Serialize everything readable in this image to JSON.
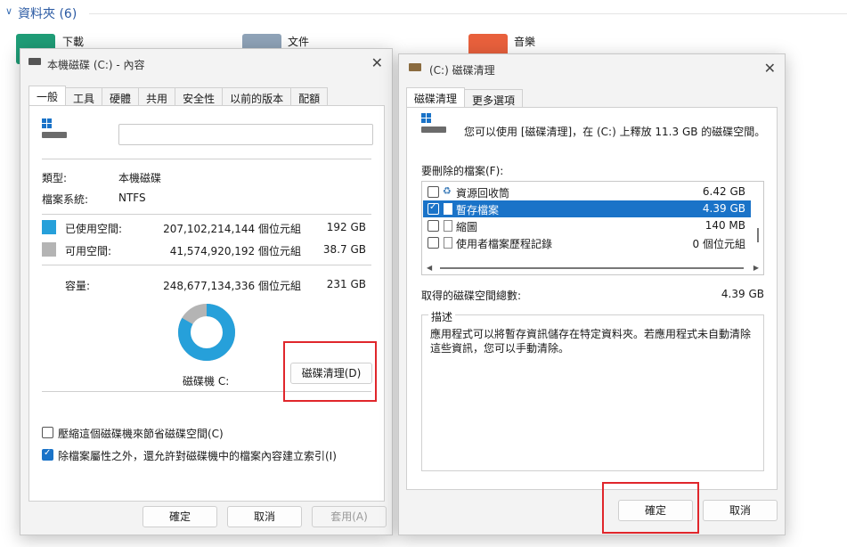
{
  "explorer": {
    "section_title": "資料夾 (6)",
    "folders": [
      {
        "label": "下載",
        "color": "#1f9d77"
      },
      {
        "label": "文件",
        "color": "#8fa3b8"
      },
      {
        "label": "音樂",
        "color": "#e8603c"
      }
    ]
  },
  "props": {
    "title": "本機磁碟 (C:) - 內容",
    "tabs": [
      "一般",
      "工具",
      "硬體",
      "共用",
      "安全性",
      "以前的版本",
      "配額"
    ],
    "name_value": "",
    "type_label": "類型:",
    "type_value": "本機磁碟",
    "fs_label": "檔案系統:",
    "fs_value": "NTFS",
    "used": {
      "label": "已使用空間:",
      "bytes": "207,102,214,144 個位元組",
      "size": "192 GB",
      "color": "#26a0da"
    },
    "free": {
      "label": "可用空間:",
      "bytes": "41,574,920,192 個位元組",
      "size": "38.7 GB",
      "color": "#b4b4b4"
    },
    "capacity": {
      "label": "容量:",
      "bytes": "248,677,134,336 個位元組",
      "size": "231 GB"
    },
    "used_fraction": 0.833,
    "drive_label": "磁碟機 C:",
    "cleanup_button": "磁碟清理(D)",
    "compress_label": "壓縮這個磁碟機來節省磁碟空間(C)",
    "compress_checked": false,
    "index_label": "除檔案屬性之外，還允許對磁碟機中的檔案內容建立索引(I)",
    "index_checked": true,
    "ok": "確定",
    "cancel": "取消",
    "apply": "套用(A)"
  },
  "cleanup": {
    "title": "(C:) 磁碟清理",
    "tabs": [
      "磁碟清理",
      "更多選項"
    ],
    "intro": "您可以使用 [磁碟清理]，在 (C:) 上釋放 11.3 GB 的磁碟空間。",
    "files_label": "要刪除的檔案(F):",
    "files": [
      {
        "name": "資源回收筒",
        "size": "6.42 GB",
        "checked": false,
        "selected": false
      },
      {
        "name": "暫存檔案",
        "size": "4.39 GB",
        "checked": true,
        "selected": true
      },
      {
        "name": "縮圖",
        "size": "140 MB",
        "checked": false,
        "selected": false
      },
      {
        "name": "使用者檔案歷程記錄",
        "size": "0 個位元組",
        "checked": false,
        "selected": false
      }
    ],
    "total_label": "取得的磁碟空間總數:",
    "total_value": "4.39 GB",
    "desc_title": "描述",
    "desc_text": "應用程式可以將暫存資訊儲存在特定資料夾。若應用程式未自動清除這些資訊，您可以手動清除。",
    "ok": "確定",
    "cancel": "取消"
  }
}
